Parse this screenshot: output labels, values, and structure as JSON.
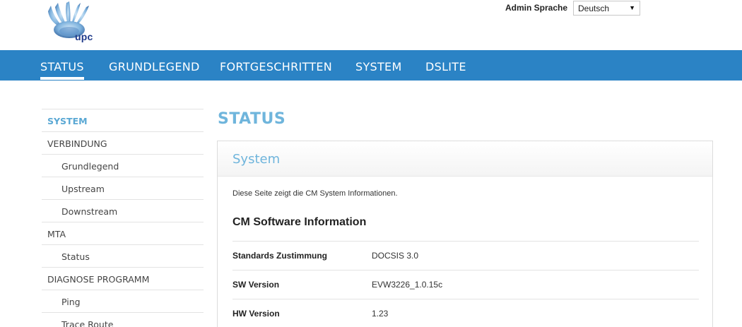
{
  "header": {
    "logo_text": "upc",
    "language_label": "Admin Sprache",
    "language_selected": "Deutsch"
  },
  "nav": {
    "items": [
      "STATUS",
      "GRUNDLEGEND",
      "FORTGESCHRITTEN",
      "SYSTEM",
      "DSLITE"
    ],
    "active": "STATUS"
  },
  "sidebar": {
    "items": [
      {
        "label": "SYSTEM",
        "level": 0,
        "active": true
      },
      {
        "label": "VERBINDUNG",
        "level": 0
      },
      {
        "label": "Grundlegend",
        "level": 1
      },
      {
        "label": "Upstream",
        "level": 1
      },
      {
        "label": "Downstream",
        "level": 1
      },
      {
        "label": "MTA",
        "level": 0
      },
      {
        "label": "Status",
        "level": 1
      },
      {
        "label": "DIAGNOSE PROGRAMM",
        "level": 0
      },
      {
        "label": "Ping",
        "level": 1
      },
      {
        "label": "Trace Route",
        "level": 1
      }
    ]
  },
  "main": {
    "page_title": "STATUS",
    "panel_title": "System",
    "description": "Diese Seite zeigt die CM System Informationen.",
    "section_title": "CM Software Information",
    "rows": [
      {
        "label": "Standards Zustimmung",
        "value": "DOCSIS 3.0"
      },
      {
        "label": "SW Version",
        "value": "EVW3226_1.0.15c"
      },
      {
        "label": "HW Version",
        "value": "1.23"
      }
    ]
  },
  "colors": {
    "nav_background": "#2b83c5",
    "accent_title": "#6fb5dc",
    "sidebar_active": "#5aa8d4"
  }
}
